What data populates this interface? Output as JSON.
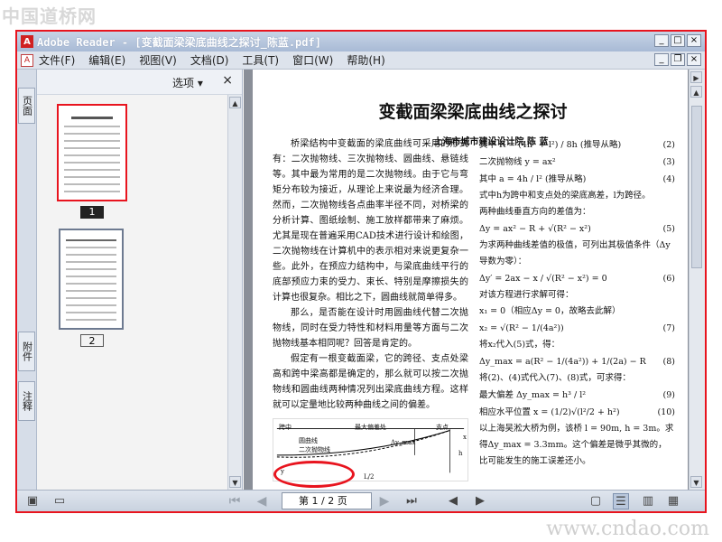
{
  "watermarks": {
    "top": "中国道桥网",
    "bottom": "www.cndao.com"
  },
  "window": {
    "title": "Adobe Reader - [变截面梁梁底曲线之探讨_陈蓝.pdf]",
    "buttons": [
      "_",
      "□",
      "×"
    ]
  },
  "menu": {
    "items": [
      "文件(F)",
      "编辑(E)",
      "视图(V)",
      "文档(D)",
      "工具(T)",
      "窗口(W)",
      "帮助(H)"
    ],
    "doc_buttons": [
      "_",
      "❐",
      "×"
    ]
  },
  "side_tabs": {
    "pages": "页面",
    "attachments": "附件",
    "comments": "注释"
  },
  "panel": {
    "options_label": "选项 ▾",
    "close": "×",
    "thumbnails": [
      {
        "label": "1",
        "selected": true
      },
      {
        "label": "2",
        "selected": false
      }
    ]
  },
  "paper": {
    "title": "变截面梁梁底曲线之探讨",
    "author": "上海市城市建设设计院 陈 蓝",
    "left_paragraphs": [
      "桥梁结构中变截面的梁底曲线可采用的形式有：二次抛物线、三次抛物线、圆曲线、悬链线等。其中最为常用的是二次抛物线。由于它与弯矩分布较为接近，从理论上来说最为经济合理。然而，二次抛物线各点曲率半径不同，对桥梁的分析计算、图纸绘制、施工放样都带来了麻烦。尤其是现在普遍采用CAD技术进行设计和绘图，二次抛物线在计算机中的表示相对来说更复杂一些。此外，在预应力结构中，与梁底曲线平行的底部预应力束的受力、束长、特别是摩擦损失的计算也很复杂。相比之下，圆曲线就简单得多。",
      "那么，是否能在设计时用圆曲线代替二次抛物线，同时在受力特性和材料用量等方面与二次抛物线基本相同呢？回答是肯定的。",
      "假定有一根变截面梁，它的跨径、支点处梁高和跨中梁高都是确定的，那么就可以按二次抛物线和圆曲线两种情况列出梁底曲线方程。这样就可以定量地比较两种曲线之间的偏差。"
    ],
    "figure_labels": {
      "mid": "跨中",
      "max_dev": "最大偏差处",
      "support": "支点",
      "circle": "圆曲线",
      "parabola": "二次抛物线",
      "delta": "Δy_max",
      "half": "L/2",
      "h": "h",
      "x": "x",
      "y": "y"
    },
    "right": [
      {
        "t": "eq",
        "text": "其中  R = (4h² + l²) / 8h   (推导从略)",
        "num": "(2)"
      },
      {
        "t": "eq",
        "text": "二次抛物线  y = ax²",
        "num": "(3)"
      },
      {
        "t": "eq",
        "text": "其中  a = 4h / l²   (推导从略)",
        "num": "(4)"
      },
      {
        "t": "p",
        "text": "式中h为跨中和支点处的梁底高差，l为跨径。"
      },
      {
        "t": "p",
        "text": "两种曲线垂直方向的差值为："
      },
      {
        "t": "eq",
        "text": "Δy = ax² − R + √(R² − x²)",
        "num": "(5)"
      },
      {
        "t": "p",
        "text": "为求两种曲线差值的极值，可列出其极值条件（Δy导数为零）："
      },
      {
        "t": "eq",
        "text": "Δy′ = 2ax − x / √(R² − x²) = 0",
        "num": "(6)"
      },
      {
        "t": "p",
        "text": "对该方程进行求解可得："
      },
      {
        "t": "p",
        "text": "x₁ = 0（相应Δy = 0，故略去此解）"
      },
      {
        "t": "eq",
        "text": "x₂ = √(R² − 1/(4a²))",
        "num": "(7)"
      },
      {
        "t": "p",
        "text": "将x₂代入(5)式，得："
      },
      {
        "t": "eq",
        "text": "Δy_max = a(R² − 1/(4a²)) + 1/(2a) − R",
        "num": "(8)"
      },
      {
        "t": "p",
        "text": "将(2)、(4)式代入(7)、(8)式，可求得："
      },
      {
        "t": "eq",
        "text": "最大偏差  Δy_max = h³ / l²",
        "num": "(9)"
      },
      {
        "t": "eq",
        "text": "相应水平位置  x = (1/2)√(l²/2 + h²)",
        "num": "(10)"
      },
      {
        "t": "p",
        "text": "以上海吴淞大桥为例，该桥 l = 90m, h = 3m。求得Δy_max = 3.3mm。这个偏差是微乎其微的，比可能发生的施工误差还小。"
      }
    ]
  },
  "statusbar": {
    "page_indicator": "第 1 / 2 页",
    "icons": [
      "panel-toggle-icon",
      "dash-icon",
      "first-page-icon",
      "prev-page-icon",
      "next-page-icon",
      "last-page-icon",
      "back-icon",
      "forward-icon",
      "single-page-icon",
      "continuous-icon",
      "facing-icon",
      "continuous-facing-icon"
    ]
  },
  "colors": {
    "highlight": "#e8141e"
  }
}
